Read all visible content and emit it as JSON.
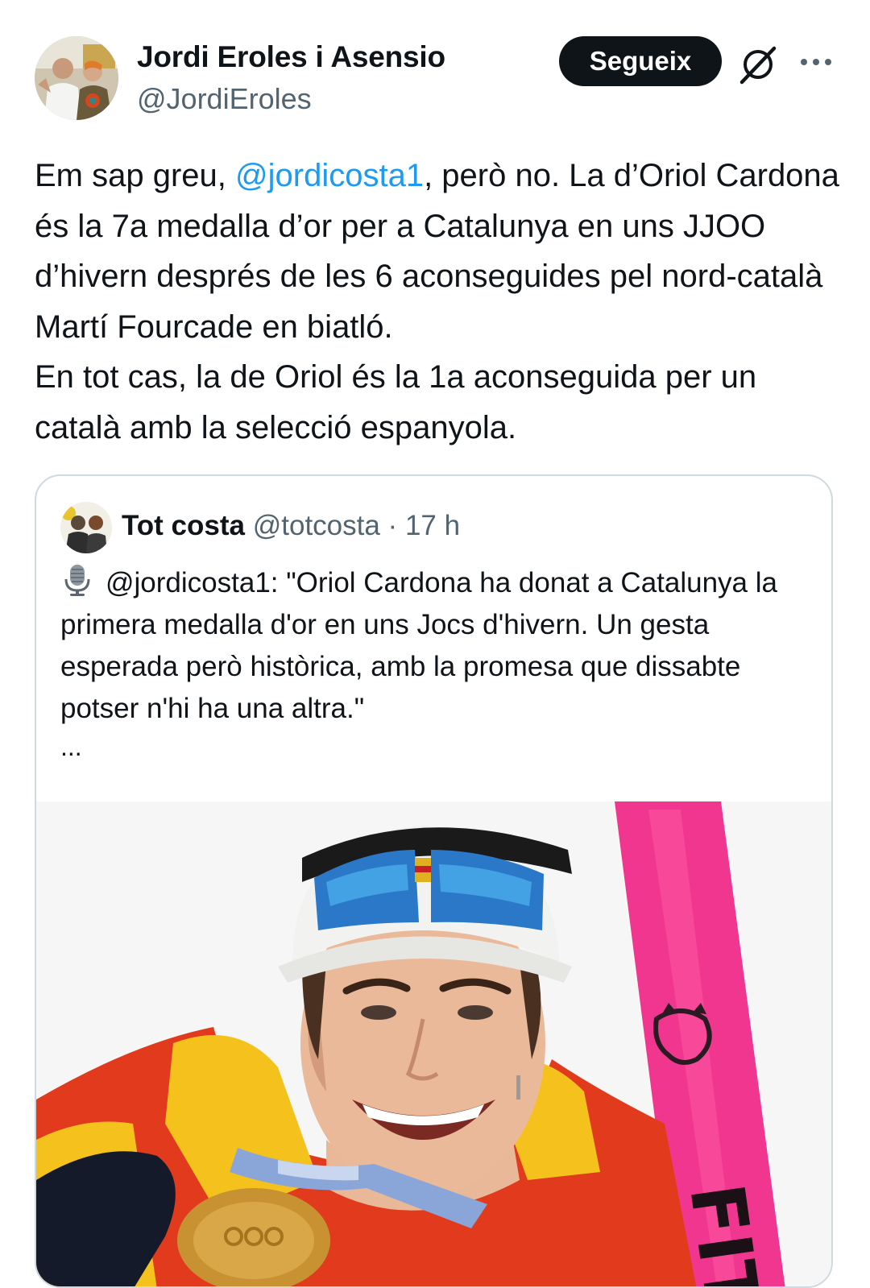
{
  "author": {
    "display_name": "Jordi Eroles i Asensio",
    "handle": "@JordiEroles",
    "avatar_icon": "profile-photo"
  },
  "actions": {
    "follow_label": "Segueix",
    "grok_icon": "grok-icon",
    "more_icon": "more-icon"
  },
  "tweet": {
    "para1_before_mention": "Em sap greu, ",
    "mention": "@jordicosta1",
    "para1_after_mention": ", però no. La d’Oriol Cardona és la 7a medalla d’or per a Catalunya en uns JJOO d’hivern després de les 6 aconseguides pel nord-català Martí Fourcade en biatló.",
    "para2": "En tot cas, la de Oriol és la 1a aconseguida per un català amb la selecció espanyola."
  },
  "quoted": {
    "display_name": "Tot costa",
    "handle": "@totcosta",
    "separator": " · ",
    "time": "17 h",
    "icon": "microphone-emoji",
    "text": "@jordicosta1: \"Oriol Cardona ha donat a Catalunya la primera medalla d'or en uns Jocs d'hivern. Un gesta esperada però històrica, amb la promesa que dissabte potser n'hi ha una altra.\"",
    "ellipsis": "...",
    "photo_icon": "athlete-photo"
  },
  "colors": {
    "text": "#0f1419",
    "secondary": "#536471",
    "link": "#1d9bf0",
    "border": "#cfd9de",
    "button_bg": "#0f1419"
  }
}
